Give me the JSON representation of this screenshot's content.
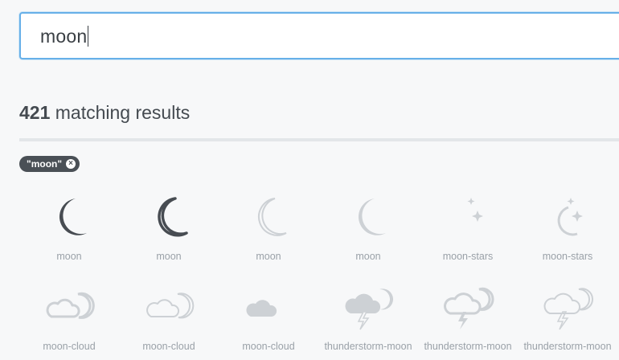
{
  "search": {
    "value": "moon"
  },
  "results": {
    "count": "421",
    "label": "matching results"
  },
  "filter_tag": {
    "label": "\"moon\"",
    "close_glyph": "×"
  },
  "colors": {
    "accent": "#67b0e8",
    "dark_icon": "#474c52",
    "light_icon": "#cdd1d5",
    "label": "#9aa1a8"
  },
  "icons": [
    {
      "label": "moon",
      "icon": "moon-solid-icon"
    },
    {
      "label": "moon",
      "icon": "moon-outline-icon"
    },
    {
      "label": "moon",
      "icon": "moon-thin-icon"
    },
    {
      "label": "moon",
      "icon": "moon-solid-light-icon"
    },
    {
      "label": "moon-stars",
      "icon": "moon-stars-solid-icon"
    },
    {
      "label": "moon-stars",
      "icon": "moon-stars-outline-icon"
    },
    {
      "label": "moon-cloud",
      "icon": "moon-cloud-outline-icon"
    },
    {
      "label": "moon-cloud",
      "icon": "moon-cloud-thin-icon"
    },
    {
      "label": "moon-cloud",
      "icon": "moon-cloud-solid-icon"
    },
    {
      "label": "thunderstorm-moon",
      "icon": "thunderstorm-moon-solid-icon"
    },
    {
      "label": "thunderstorm-moon",
      "icon": "thunderstorm-moon-outline-icon"
    },
    {
      "label": "thunderstorm-moon",
      "icon": "thunderstorm-moon-thin-icon"
    }
  ]
}
